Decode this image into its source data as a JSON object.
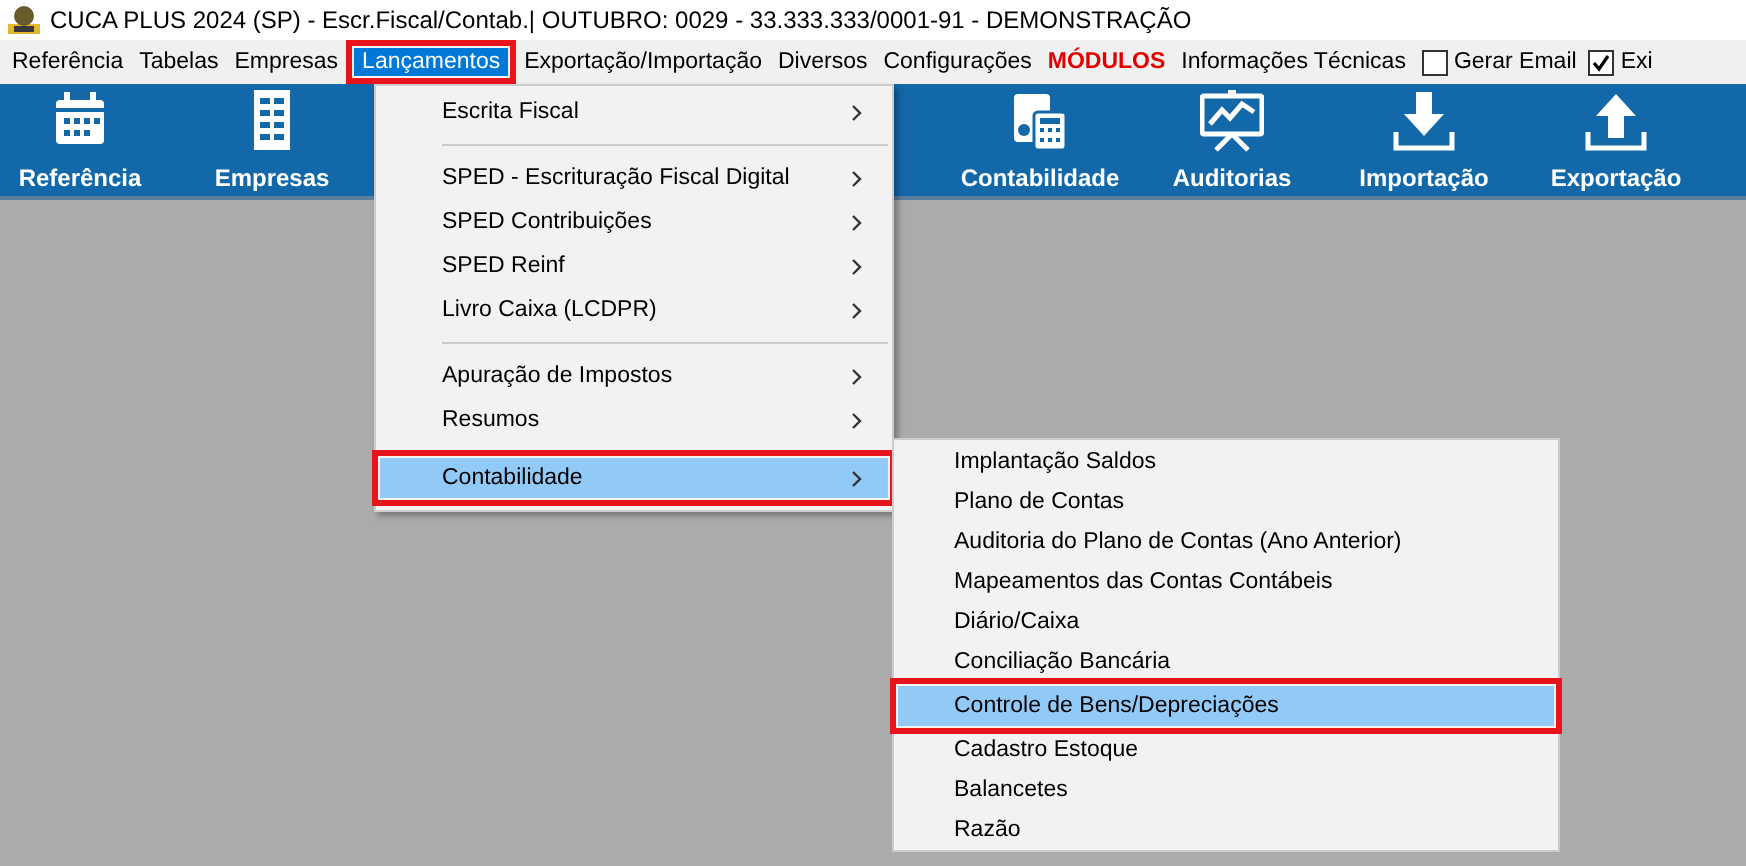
{
  "window": {
    "title": "CUCA PLUS 2024 (SP) - Escr.Fiscal/Contab.| OUTUBRO: 0029 - 33.333.333/0001-91 - DEMONSTRAÇÃO"
  },
  "menu_bar": {
    "items": [
      {
        "label": "Referência",
        "kind": "menu",
        "selected": false,
        "highlighted": false
      },
      {
        "label": "Tabelas",
        "kind": "menu",
        "selected": false,
        "highlighted": false
      },
      {
        "label": "Empresas",
        "kind": "menu",
        "selected": false,
        "highlighted": false
      },
      {
        "label": "Lançamentos",
        "kind": "menu",
        "selected": true,
        "highlighted": true
      },
      {
        "label": "Exportação/Importação",
        "kind": "menu",
        "selected": false,
        "highlighted": false
      },
      {
        "label": "Diversos",
        "kind": "menu",
        "selected": false,
        "highlighted": false
      },
      {
        "label": "Configurações",
        "kind": "menu",
        "selected": false,
        "highlighted": false
      },
      {
        "label": "MÓDULOS",
        "kind": "alert",
        "selected": false,
        "highlighted": false
      },
      {
        "label": "Informações Técnicas",
        "kind": "menu",
        "selected": false,
        "highlighted": false
      },
      {
        "label": "Gerar Email",
        "kind": "checkbox",
        "checked": false
      },
      {
        "label": "Exi",
        "kind": "checkbox",
        "checked": true
      }
    ]
  },
  "toolbar": {
    "left": [
      {
        "label": "Referência"
      },
      {
        "label": "Empresas"
      }
    ],
    "right": [
      {
        "label": "Contabilidade"
      },
      {
        "label": "Auditorias"
      },
      {
        "label": "Importação"
      },
      {
        "label": "Exportação"
      }
    ]
  },
  "dropdown": {
    "items": [
      {
        "kind": "item",
        "label": "Escrita Fiscal",
        "selected": false,
        "highlighted": false
      },
      {
        "kind": "separator"
      },
      {
        "kind": "item",
        "label": "SPED - Escrituração Fiscal Digital",
        "selected": false,
        "highlighted": false
      },
      {
        "kind": "item",
        "label": "SPED Contribuições",
        "selected": false,
        "highlighted": false
      },
      {
        "kind": "item",
        "label": "SPED Reinf",
        "selected": false,
        "highlighted": false
      },
      {
        "kind": "item",
        "label": "Livro Caixa (LCDPR)",
        "selected": false,
        "highlighted": false
      },
      {
        "kind": "separator"
      },
      {
        "kind": "item",
        "label": "Apuração de Impostos",
        "selected": false,
        "highlighted": false
      },
      {
        "kind": "item",
        "label": "Resumos",
        "selected": false,
        "highlighted": false
      },
      {
        "kind": "item",
        "label": "Contabilidade",
        "selected": true,
        "highlighted": true
      }
    ]
  },
  "submenu": {
    "items": [
      {
        "label": "Implantação Saldos",
        "selected": false,
        "highlighted": false
      },
      {
        "label": "Plano de Contas",
        "selected": false,
        "highlighted": false
      },
      {
        "label": "Auditoria do Plano de Contas (Ano Anterior)",
        "selected": false,
        "highlighted": false
      },
      {
        "label": "Mapeamentos das Contas Contábeis",
        "selected": false,
        "highlighted": false
      },
      {
        "label": "Diário/Caixa",
        "selected": false,
        "highlighted": false
      },
      {
        "label": "Conciliação Bancária",
        "selected": false,
        "highlighted": false
      },
      {
        "label": "Controle de Bens/Depreciações",
        "selected": true,
        "highlighted": true
      },
      {
        "label": "Cadastro Estoque",
        "selected": false,
        "highlighted": false
      },
      {
        "label": "Balancetes",
        "selected": false,
        "highlighted": false
      },
      {
        "label": "Razão",
        "selected": false,
        "highlighted": false
      }
    ]
  }
}
